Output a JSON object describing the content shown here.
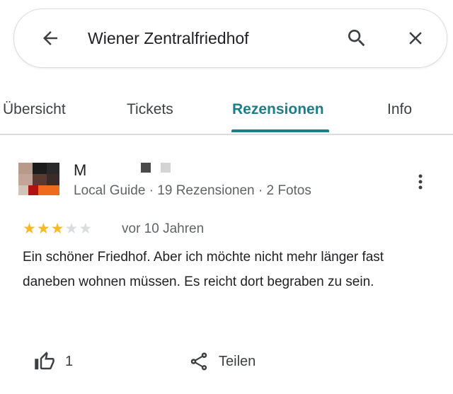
{
  "search": {
    "query": "Wiener Zentralfriedhof"
  },
  "tabs": [
    {
      "label": "Übersicht",
      "active": false
    },
    {
      "label": "Tickets",
      "active": false
    },
    {
      "label": "Rezensionen",
      "active": true
    },
    {
      "label": "Info",
      "active": false
    }
  ],
  "review": {
    "reviewer_initial": "M",
    "meta": "Local Guide · 19 Rezensionen · 2 Fotos",
    "rating": 3,
    "rating_max": 5,
    "date": "vor 10 Jahren",
    "text": "Ein schöner Friedhof. Aber ich möchte nicht mehr länger fast daneben wohnen müssen. Es reicht dort begraben zu sein.",
    "likes": "1",
    "share_label": "Teilen"
  },
  "icons": {
    "back": "arrow-left-icon",
    "search": "search-icon",
    "close": "close-icon",
    "more": "more-vert-icon",
    "like": "thumb-up-icon",
    "share": "share-icon"
  },
  "colors": {
    "accent": "#1a7f8a",
    "star_filled": "#f7b928",
    "star_empty": "#dadce0",
    "secondary_text": "#5f6368"
  }
}
